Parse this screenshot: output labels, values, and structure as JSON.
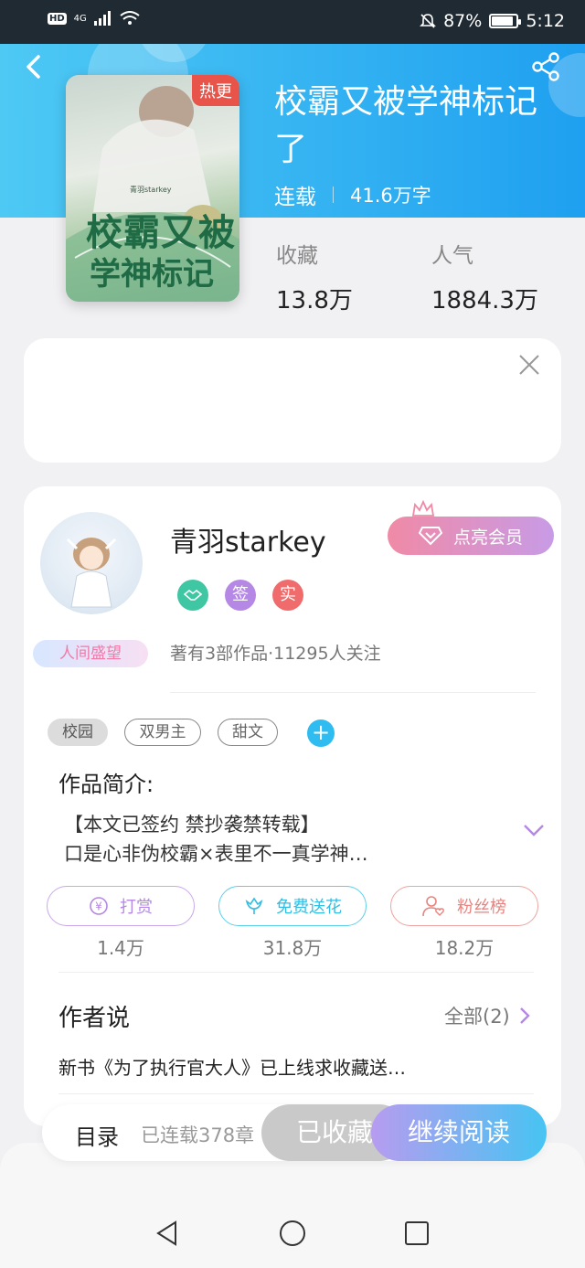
{
  "status_bar": {
    "hd": "HD",
    "network": "4G",
    "battery_percent": "87%",
    "battery_level": 0.87,
    "time": "5:12"
  },
  "book": {
    "hot_badge": "热更",
    "title": "校霸又被学神标记了",
    "cover_line1": "校霸又被",
    "cover_line2": "学神标记",
    "cover_author": "青羽starkey",
    "status": "连载",
    "word_count": "41.6万字",
    "stats": [
      {
        "label": "收藏",
        "value": "13.8万"
      },
      {
        "label": "人气",
        "value": "1884.3万"
      }
    ]
  },
  "author": {
    "name": "青羽starkey",
    "badge_label": "人间盛望",
    "vip_label": "点亮会员",
    "badges": [
      "签",
      "实"
    ],
    "meta": "著有3部作品·11295人关注"
  },
  "tags": [
    "校园",
    "双男主",
    "甜文"
  ],
  "intro": {
    "title": "作品简介:",
    "lines": [
      "【本文已签约 禁抄袭禁转载】",
      "口是心非伪校霸×表里不一真学神…"
    ]
  },
  "actions": [
    {
      "label": "打赏",
      "count": "1.4万",
      "color": "#b88fe0"
    },
    {
      "label": "免费送花",
      "count": "31.8万",
      "color": "#43c6e6"
    },
    {
      "label": "粉丝榜",
      "count": "18.2万",
      "color": "#e8837f"
    }
  ],
  "author_says": {
    "title": "作者说",
    "all_label": "全部(2)",
    "latest": "新书《为了执行官大人》已上线求收藏送…"
  },
  "bottom_bar": {
    "toc_label": "目录",
    "chapters": "已连载378章",
    "collected_label": "已收藏",
    "read_label": "继续阅读"
  },
  "colors": {
    "hero_start": "#4ec9f4",
    "hero_end": "#1fa0f0",
    "accent_purple": "#b79cf0"
  }
}
